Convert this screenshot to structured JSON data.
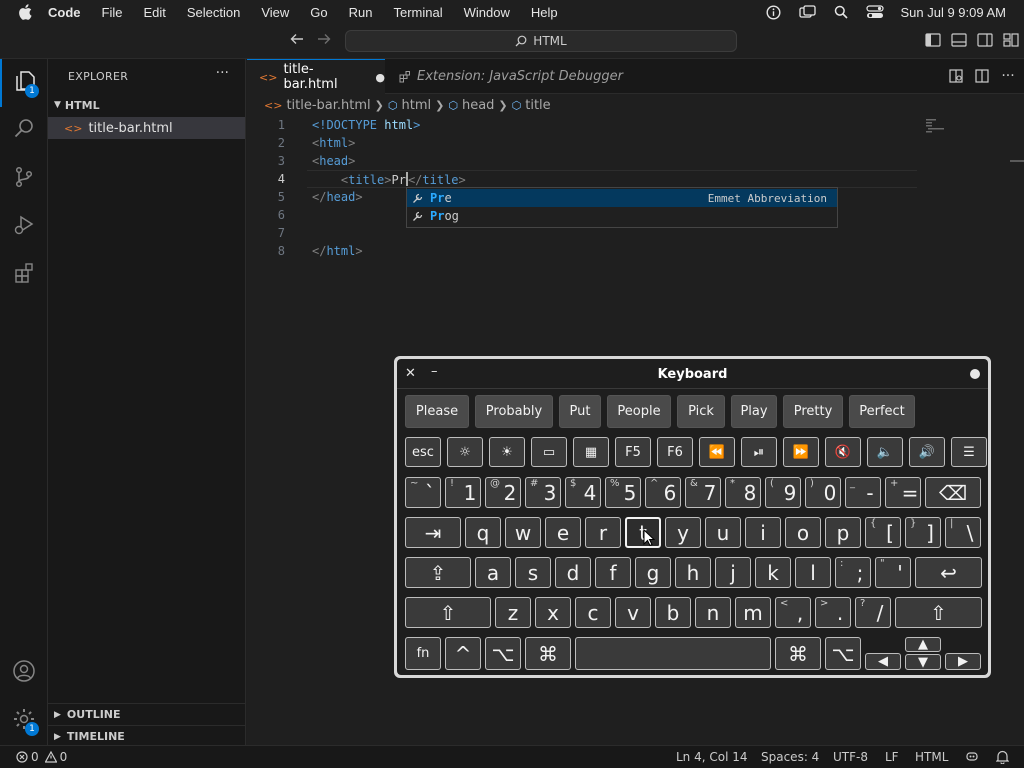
{
  "menubar": {
    "app_name": "Code",
    "items": [
      "File",
      "Edit",
      "Selection",
      "View",
      "Go",
      "Run",
      "Terminal",
      "Window",
      "Help"
    ],
    "clock": "Sun Jul 9  9:09 AM"
  },
  "titlebar": {
    "command_center": "HTML"
  },
  "activity": {
    "explorer_badge": "1",
    "settings_badge": "1"
  },
  "sidebar": {
    "title": "EXPLORER",
    "more": "···",
    "folder": "HTML",
    "file": "title-bar.html",
    "outline": "OUTLINE",
    "timeline": "TIMELINE"
  },
  "tabs": [
    {
      "label": "title-bar.html",
      "dirty": "●"
    },
    {
      "label": "Extension: JavaScript Debugger"
    }
  ],
  "tab_more": "···",
  "breadcrumb": {
    "file": "title-bar.html",
    "items": [
      "html",
      "head",
      "title"
    ]
  },
  "editor": {
    "line_numbers": [
      "1",
      "2",
      "3",
      "4",
      "5",
      "6",
      "7",
      "8"
    ],
    "current_line": "4",
    "lines": {
      "l1a": "<!DOCTYPE ",
      "l1b": "html",
      "l1c": ">",
      "l2": "html",
      "l3": "head",
      "l4_tag": "title",
      "l4_text": "Pr",
      "l4_close": "title",
      "l5": "head",
      "l8": "html"
    }
  },
  "suggest": {
    "items": [
      {
        "match": "Pr",
        "rest": "e",
        "detail": "Emmet Abbreviation"
      },
      {
        "match": "Pr",
        "rest": "og",
        "detail": ""
      }
    ]
  },
  "keyboard": {
    "title": "Keyboard",
    "close": "✕",
    "minimize": "–",
    "predictions": [
      "Please",
      "Probably",
      "Put",
      "People",
      "Pick",
      "Play",
      "Pretty",
      "Perfect"
    ],
    "frow": [
      "esc",
      "☼",
      "☀",
      "▭",
      "▦",
      "F5",
      "F6",
      "⏪",
      "⏯",
      "⏩",
      "🔇",
      "🔈",
      "🔊",
      "☰"
    ],
    "numrow": [
      {
        "s": "~",
        "b": "`"
      },
      {
        "s": "!",
        "b": "1"
      },
      {
        "s": "@",
        "b": "2"
      },
      {
        "s": "#",
        "b": "3"
      },
      {
        "s": "$",
        "b": "4"
      },
      {
        "s": "%",
        "b": "5"
      },
      {
        "s": "^",
        "b": "6"
      },
      {
        "s": "&",
        "b": "7"
      },
      {
        "s": "*",
        "b": "8"
      },
      {
        "s": "(",
        "b": "9"
      },
      {
        "s": ")",
        "b": "0"
      },
      {
        "s": "_",
        "b": "-"
      },
      {
        "s": "+",
        "b": "="
      }
    ],
    "qrow": [
      "q",
      "w",
      "e",
      "r",
      "t",
      "y",
      "u",
      "i",
      "o",
      "p"
    ],
    "qrow_sym": [
      {
        "s": "{",
        "b": "["
      },
      {
        "s": "}",
        "b": "]"
      },
      {
        "s": "|",
        "b": "\\"
      }
    ],
    "arow": [
      "a",
      "s",
      "d",
      "f",
      "g",
      "h",
      "j",
      "k",
      "l"
    ],
    "arow_sym": [
      {
        "s": ":",
        "b": ";"
      },
      {
        "s": "\"",
        "b": "'"
      }
    ],
    "zrow": [
      "z",
      "x",
      "c",
      "v",
      "b",
      "n",
      "m"
    ],
    "zrow_sym": [
      {
        "s": "<",
        "b": ","
      },
      {
        "s": ">",
        "b": "."
      },
      {
        "s": "?",
        "b": "/"
      }
    ],
    "mods": {
      "tab": "⇥",
      "caps": "⇪",
      "shift": "⇧",
      "delete": "⌫",
      "return": "↩",
      "fn": "fn",
      "ctrl": "^",
      "opt": "⌥",
      "cmd": "⌘",
      "up": "▲",
      "down": "▼",
      "left": "◀",
      "right": "▶"
    }
  },
  "statusbar": {
    "errors": "0",
    "warnings": "0",
    "position": "Ln 4, Col 14",
    "spaces": "Spaces: 4",
    "encoding": "UTF-8",
    "eol": "LF",
    "language": "HTML"
  }
}
